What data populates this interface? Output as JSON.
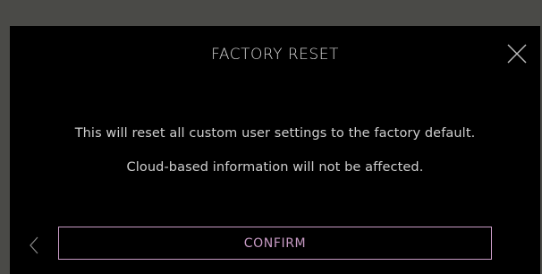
{
  "dialog": {
    "title": "FACTORY RESET",
    "message_line1": "This will reset all custom user settings to the factory default.",
    "message_line2": "Cloud-based information will not be affected.",
    "confirm_label": "CONFIRM",
    "close_icon": "close-icon",
    "back_icon": "chevron-left-icon"
  },
  "colors": {
    "backdrop": "#4a4a47",
    "dialog_background": "#000000",
    "text": "#cfcfcf",
    "accent": "#c79ac4"
  }
}
